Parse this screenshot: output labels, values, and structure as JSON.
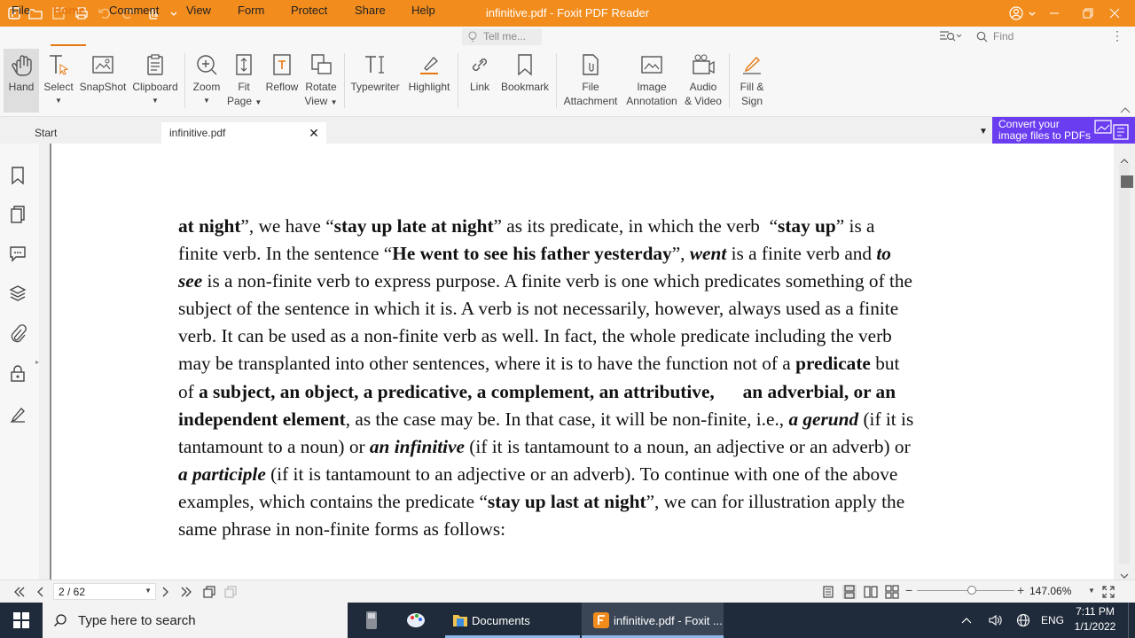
{
  "window": {
    "title": "infinitive.pdf - Foxit PDF Reader"
  },
  "menu": {
    "items": [
      "File",
      "Home",
      "Comment",
      "View",
      "Form",
      "Protect",
      "Share",
      "Help"
    ],
    "active": "Home",
    "tell_me_placeholder": "Tell me...",
    "find_placeholder": "Find"
  },
  "ribbon": {
    "tools": [
      {
        "label": "Hand",
        "icon": "hand-icon"
      },
      {
        "label": "Select",
        "icon": "select-text-icon"
      },
      {
        "label": "SnapShot",
        "icon": "snapshot-icon"
      },
      {
        "label": "Clipboard",
        "icon": "clipboard-icon"
      },
      {
        "label": "Zoom",
        "icon": "zoom-icon"
      },
      {
        "label": "Fit Page",
        "icon": "fit-page-icon"
      },
      {
        "label": "Reflow",
        "icon": "reflow-icon"
      },
      {
        "label": "Rotate View",
        "icon": "rotate-view-icon"
      },
      {
        "label": "Typewriter",
        "icon": "typewriter-icon"
      },
      {
        "label": "Highlight",
        "icon": "highlight-icon"
      },
      {
        "label": "Link",
        "icon": "link-icon"
      },
      {
        "label": "Bookmark",
        "icon": "bookmark-icon"
      },
      {
        "label": "File Attachment",
        "icon": "file-attachment-icon"
      },
      {
        "label": "Image Annotation",
        "icon": "image-annotation-icon"
      },
      {
        "label": "Audio & Video",
        "icon": "audio-video-icon"
      },
      {
        "label": "Fill & Sign",
        "icon": "fill-sign-icon"
      }
    ],
    "labels": {
      "hand": "Hand",
      "select": "Select",
      "snapshot": "SnapShot",
      "clipboard": "Clipboard",
      "zoom": "Zoom",
      "fit1": "Fit",
      "fit2": "Page",
      "reflow": "Reflow",
      "rotate1": "Rotate",
      "rotate2": "View",
      "typewriter": "Typewriter",
      "highlight": "Highlight",
      "link": "Link",
      "bookmark": "Bookmark",
      "attach1": "File",
      "attach2": "Attachment",
      "image1": "Image",
      "image2": "Annotation",
      "audio1": "Audio",
      "audio2": "& Video",
      "fill1": "Fill &",
      "fill2": "Sign"
    }
  },
  "tabs": [
    {
      "label": "Start"
    },
    {
      "label": "infinitive.pdf",
      "active": true
    }
  ],
  "ad_banner": {
    "line1": "Convert your",
    "line2": "image files to PDFs"
  },
  "document": {
    "lines": [
      [
        {
          "t": "at night",
          "b": true
        },
        {
          "t": "”, we have “"
        },
        {
          "t": "stay up late at night",
          "b": true
        },
        {
          "t": "” as its predicate, in which the verb  “"
        },
        {
          "t": "stay up",
          "b": true
        },
        {
          "t": "” is a"
        }
      ],
      [
        {
          "t": "finite verb. In the sentence “"
        },
        {
          "t": "He went to see his father yesterday",
          "b": true
        },
        {
          "t": "”, "
        },
        {
          "t": "went",
          "b": true,
          "i": true
        },
        {
          "t": " is a finite verb and "
        },
        {
          "t": "to",
          "b": true,
          "i": true
        }
      ],
      [
        {
          "t": "see",
          "b": true,
          "i": true
        },
        {
          "t": " is a non-finite verb to express purpose. A finite verb is one which predicates something of the"
        }
      ],
      [
        {
          "t": "subject of the sentence in which it is. A verb is not necessarily, however, always used as a finite"
        }
      ],
      [
        {
          "t": "verb. It can be used as a non-finite verb as well. In fact, the whole predicate including the verb"
        }
      ],
      [
        {
          "t": "may be transplanted into other sentences, where it is to have the function not of a "
        },
        {
          "t": "predicate",
          "b": true
        },
        {
          "t": " but"
        }
      ],
      [
        {
          "t": "of "
        },
        {
          "t": "a subject, an object, a predicative, a complement, an attributive,      an adverbial, or an",
          "b": true
        }
      ],
      [
        {
          "t": "independent element",
          "b": true
        },
        {
          "t": ", as the case may be. In that case, it will be non-finite, i.e., "
        },
        {
          "t": "a gerund",
          "b": true,
          "i": true
        },
        {
          "t": " (if it is"
        }
      ],
      [
        {
          "t": "tantamount to a noun) or "
        },
        {
          "t": "an infinitive",
          "b": true,
          "i": true
        },
        {
          "t": " (if it is tantamount to a noun, an adjective or an adverb) or"
        }
      ],
      [
        {
          "t": "a participle",
          "b": true,
          "i": true
        },
        {
          "t": " (if it is tantamount to an adjective or an adverb). To continue with one of the above"
        }
      ],
      [
        {
          "t": "examples, which contains the predicate “"
        },
        {
          "t": "stay up last at night",
          "b": true
        },
        {
          "t": "”, we can for illustration apply the"
        }
      ],
      [
        {
          "t": "same phrase in non-finite forms as follows:"
        }
      ]
    ]
  },
  "status": {
    "page": "2 / 62",
    "zoom": "147.06%"
  },
  "taskbar": {
    "search_placeholder": "Type here to search",
    "apps": [
      {
        "label": "Documents"
      },
      {
        "label": "infinitive.pdf - Foxit ..."
      }
    ],
    "lang": "ENG",
    "time": "7:11 PM",
    "date": "1/1/2022"
  }
}
